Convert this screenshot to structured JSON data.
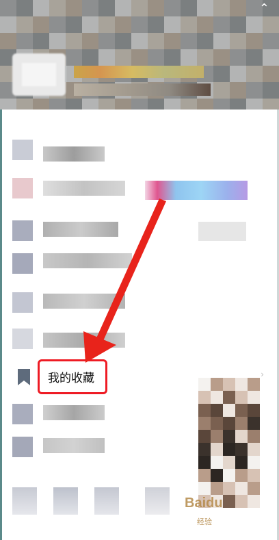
{
  "favorites_item": {
    "label": "我的收藏"
  },
  "watermark": {
    "brand": "Baidu",
    "sub": "经验"
  },
  "colors": {
    "highlight_red": "#ee1b24",
    "arrow_red": "#e8231b",
    "bookmark_icon": "#5e6b7c"
  },
  "icons": {
    "bookmark": "bookmark-icon",
    "chevron": "chevron-right-icon",
    "close": "close-icon"
  }
}
